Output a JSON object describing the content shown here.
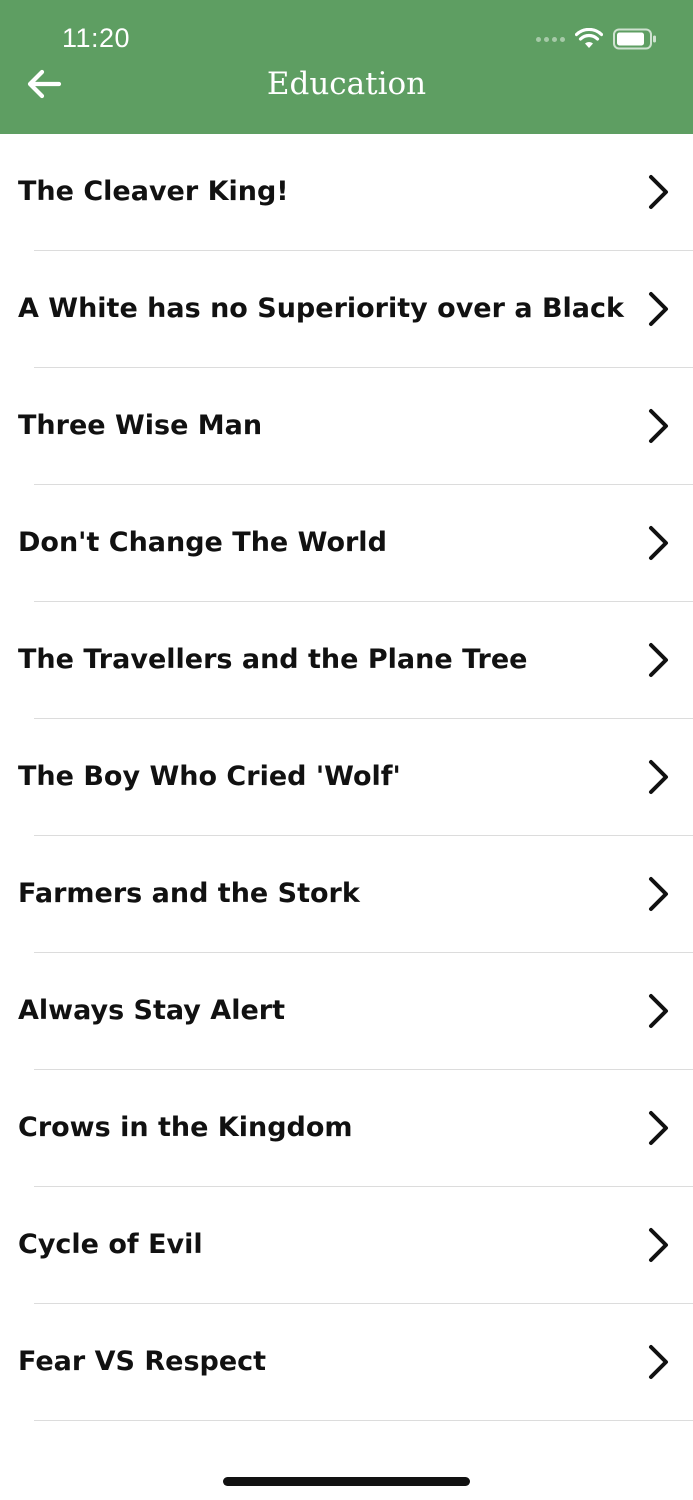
{
  "status_bar": {
    "time": "11:20"
  },
  "header": {
    "title": "Education",
    "background_color": "#5e9e62"
  },
  "icons": {
    "back": "arrow-left-icon",
    "row": "chevron-right-icon"
  },
  "items": [
    {
      "label": "The Cleaver King!"
    },
    {
      "label": "A White has no Superiority over a Black"
    },
    {
      "label": "Three Wise Man"
    },
    {
      "label": "Don't Change The World"
    },
    {
      "label": "The Travellers and the Plane Tree"
    },
    {
      "label": "The Boy Who Cried 'Wolf'"
    },
    {
      "label": "Farmers and the Stork"
    },
    {
      "label": "Always Stay Alert"
    },
    {
      "label": "Crows in the Kingdom"
    },
    {
      "label": "Cycle of Evil"
    },
    {
      "label": "Fear VS Respect"
    }
  ]
}
